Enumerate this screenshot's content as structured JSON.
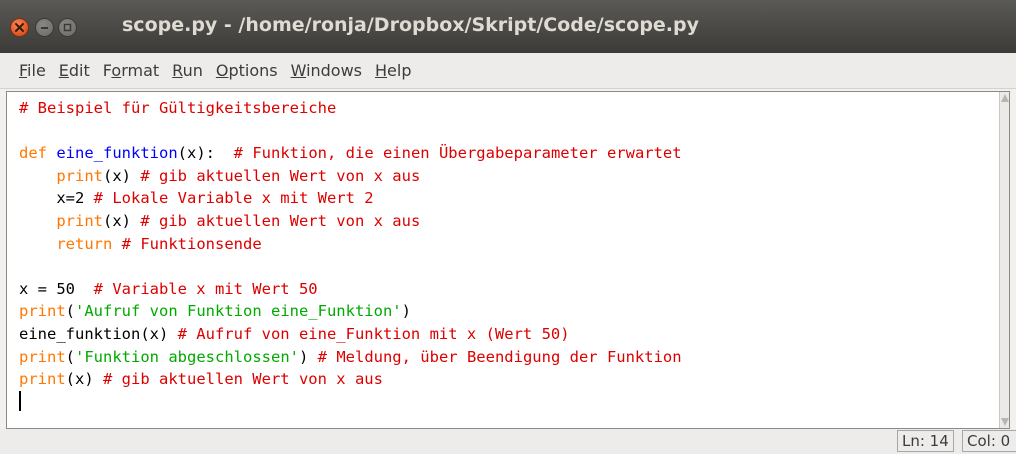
{
  "window": {
    "title": "scope.py - /home/ronja/Dropbox/Skript/Code/scope.py"
  },
  "menu": {
    "items": [
      {
        "underline": "F",
        "rest": "ile"
      },
      {
        "underline": "E",
        "rest": "dit"
      },
      {
        "pre": "F",
        "underline": "o",
        "rest": "rmat"
      },
      {
        "underline": "R",
        "rest": "un"
      },
      {
        "underline": "O",
        "rest": "ptions"
      },
      {
        "underline": "W",
        "rest": "indows"
      },
      {
        "underline": "H",
        "rest": "elp"
      }
    ]
  },
  "editor": {
    "lines": [
      [
        {
          "t": "# Beispiel für Gültigkeitsbereiche",
          "c": "comment"
        }
      ],
      [],
      [
        {
          "t": "def",
          "c": "keyword"
        },
        {
          "t": " ",
          "c": "plain"
        },
        {
          "t": "eine_funktion",
          "c": "def"
        },
        {
          "t": "(x):  ",
          "c": "plain"
        },
        {
          "t": "# Funktion, die einen Übergabeparameter erwartet",
          "c": "comment"
        }
      ],
      [
        {
          "t": "    print",
          "c": "keyword"
        },
        {
          "t": "(x) ",
          "c": "plain"
        },
        {
          "t": "# gib aktuellen Wert von x aus",
          "c": "comment"
        }
      ],
      [
        {
          "t": "    x=2 ",
          "c": "plain"
        },
        {
          "t": "# Lokale Variable x mit Wert 2",
          "c": "comment"
        }
      ],
      [
        {
          "t": "    print",
          "c": "keyword"
        },
        {
          "t": "(x) ",
          "c": "plain"
        },
        {
          "t": "# gib aktuellen Wert von x aus",
          "c": "comment"
        }
      ],
      [
        {
          "t": "    return",
          "c": "keyword"
        },
        {
          "t": " ",
          "c": "plain"
        },
        {
          "t": "# Funktionsende",
          "c": "comment"
        }
      ],
      [],
      [
        {
          "t": "x = 50  ",
          "c": "plain"
        },
        {
          "t": "# Variable x mit Wert 50",
          "c": "comment"
        }
      ],
      [
        {
          "t": "print",
          "c": "keyword"
        },
        {
          "t": "(",
          "c": "plain"
        },
        {
          "t": "'Aufruf von Funktion eine_Funktion'",
          "c": "string"
        },
        {
          "t": ")",
          "c": "plain"
        }
      ],
      [
        {
          "t": "eine_funktion(x) ",
          "c": "plain"
        },
        {
          "t": "# Aufruf von eine_Funktion mit x (Wert 50)",
          "c": "comment"
        }
      ],
      [
        {
          "t": "print",
          "c": "keyword"
        },
        {
          "t": "(",
          "c": "plain"
        },
        {
          "t": "'Funktion abgeschlossen'",
          "c": "string"
        },
        {
          "t": ") ",
          "c": "plain"
        },
        {
          "t": "# Meldung, über Beendigung der Funktion",
          "c": "comment"
        }
      ],
      [
        {
          "t": "print",
          "c": "keyword"
        },
        {
          "t": "(x) ",
          "c": "plain"
        },
        {
          "t": "# gib aktuellen Wert von x aus",
          "c": "comment"
        }
      ],
      []
    ],
    "cursor_line": 14
  },
  "status": {
    "ln": "Ln: 14",
    "col": "Col: 0"
  },
  "colors": {
    "comment": "#dd0000",
    "keyword": "#ff7700",
    "def": "#0000ff",
    "string": "#00aa00",
    "plain": "#000000",
    "close_button": "#e05a26"
  },
  "icons": [
    "close-icon",
    "minimize-icon",
    "maximize-icon"
  ]
}
